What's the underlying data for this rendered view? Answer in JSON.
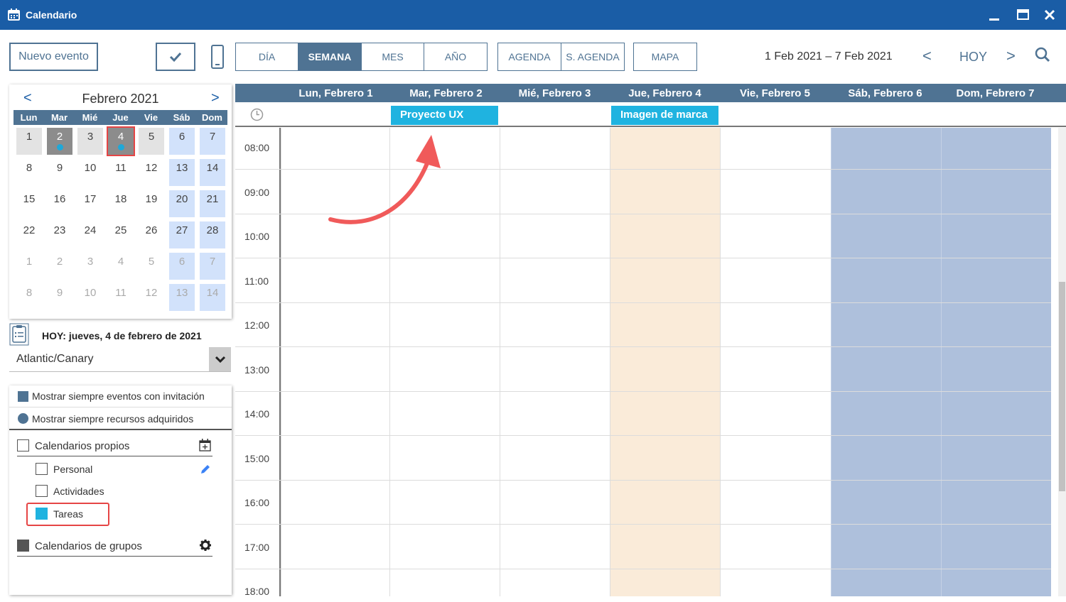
{
  "window": {
    "title": "Calendario"
  },
  "toolbar": {
    "new_event": "Nuevo evento",
    "views": [
      "DÍA",
      "SEMANA",
      "MES",
      "AÑO"
    ],
    "active_view": "SEMANA",
    "agenda_views": [
      "AGENDA",
      "S. AGENDA"
    ],
    "map": "MAPA",
    "date_range": "1 Feb 2021 – 7 Feb 2021",
    "prev": "<",
    "today": "HOY",
    "next": ">"
  },
  "minical": {
    "prev": "<",
    "next": ">",
    "title": "Febrero 2021",
    "weekdays": [
      "Lun",
      "Mar",
      "Mié",
      "Jue",
      "Vie",
      "Sáb",
      "Dom"
    ],
    "weeks": [
      [
        "1",
        "2",
        "3",
        "4",
        "5",
        "6",
        "7"
      ],
      [
        "8",
        "9",
        "10",
        "11",
        "12",
        "13",
        "14"
      ],
      [
        "15",
        "16",
        "17",
        "18",
        "19",
        "20",
        "21"
      ],
      [
        "22",
        "23",
        "24",
        "25",
        "26",
        "27",
        "28"
      ],
      [
        "1",
        "2",
        "3",
        "4",
        "5",
        "6",
        "7"
      ],
      [
        "8",
        "9",
        "10",
        "11",
        "12",
        "13",
        "14"
      ]
    ]
  },
  "today_label": "HOY: jueves, 4 de febrero de 2021",
  "timezone": "Atlantic/Canary",
  "options": {
    "show_invitations": "Mostrar siempre eventos con invitación",
    "show_resources": "Mostrar siempre recursos adquiridos"
  },
  "calendars": {
    "own_title": "Calendarios propios",
    "items": [
      "Personal",
      "Actividades",
      "Tareas"
    ],
    "groups_title": "Calendarios de grupos"
  },
  "week": {
    "days": [
      "Lun, Febrero 1",
      "Mar, Febrero 2",
      "Mié, Febrero 3",
      "Jue, Febrero 4",
      "Vie, Febrero 5",
      "Sáb, Febrero 6",
      "Dom, Febrero 7"
    ],
    "events": [
      "Proyecto UX",
      "Imagen de marca"
    ],
    "hours": [
      "08:00",
      "09:00",
      "10:00",
      "11:00",
      "12:00",
      "13:00",
      "14:00",
      "15:00",
      "16:00",
      "17:00",
      "18:00"
    ]
  },
  "colors": {
    "titlebar": "#1a5da6",
    "accent": "#4f7393",
    "event": "#1fb3e0",
    "today_column": "#faebd9",
    "weekend_column": "#aec0dc",
    "highlight": "#e64545"
  }
}
